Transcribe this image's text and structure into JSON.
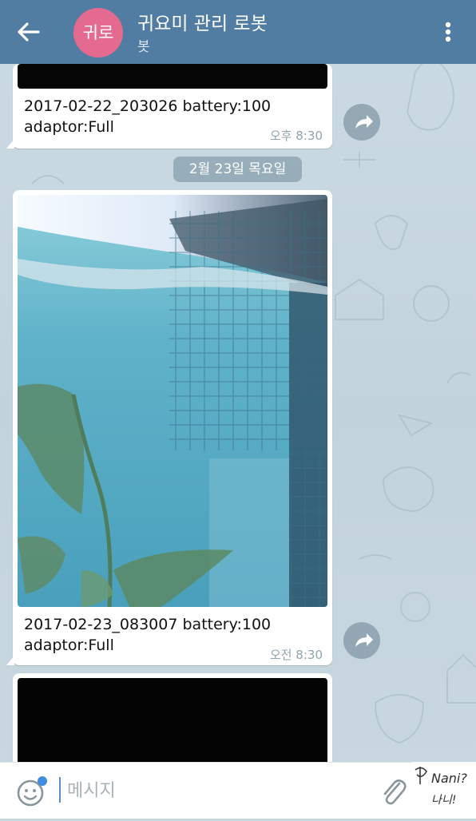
{
  "header": {
    "avatar_text": "귀로",
    "title": "귀요미 관리 로봇",
    "subtitle": "봇",
    "avatar_color": "#e56a8f",
    "bar_color": "#527da3"
  },
  "messages": [
    {
      "caption": "2017-02-22_203026 battery:100\nadaptor:Full",
      "time": "오후 8:30"
    },
    {
      "caption": "2017-02-23_083007 battery:100\nadaptor:Full",
      "time": "오전 8:30"
    }
  ],
  "date_separator": "2월 23일 목요일",
  "input": {
    "placeholder": "메시지"
  },
  "sticker_text": {
    "line1": "Nani?",
    "line2": "나니!"
  },
  "icons": {
    "back": "arrow-left-icon",
    "menu": "more-vertical-icon",
    "share": "share-forward-icon",
    "emoji": "emoji-smile-icon",
    "attach": "paperclip-icon"
  }
}
